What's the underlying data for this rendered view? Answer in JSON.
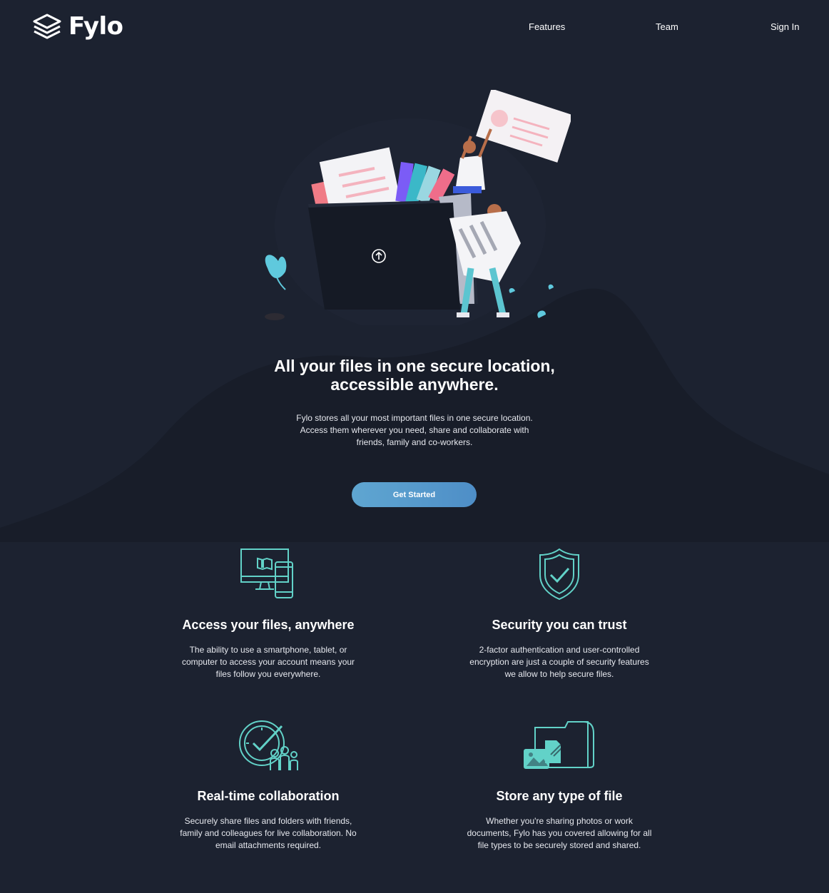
{
  "brand": {
    "name": "Fylo",
    "logo_icon": "stacked-layers-icon"
  },
  "nav": {
    "items": [
      {
        "label": "Features"
      },
      {
        "label": "Team"
      },
      {
        "label": "Sign In"
      }
    ]
  },
  "hero": {
    "title_line1": "All your files in one secure location,",
    "title_line2": "accessible anywhere.",
    "description_line1": "Fylo stores all your most important files in one secure location.",
    "description_line2": "Access them wherever you need, share and collaborate with",
    "description_line3": "friends, family and co-workers.",
    "cta_label": "Get Started"
  },
  "features": [
    {
      "icon": "devices-icon",
      "title": "Access your files, anywhere",
      "lines": [
        "The ability to use a smartphone, tablet, or",
        "computer to access your account means your",
        "files follow you everywhere."
      ]
    },
    {
      "icon": "security-shield-icon",
      "title": "Security you can trust",
      "lines": [
        "2-factor authentication and user-controlled",
        "encryption are just a couple of security features",
        "we allow to help secure files."
      ]
    },
    {
      "icon": "collaboration-icon",
      "title": "Real-time collaboration",
      "lines": [
        "Securely share files and folders with friends,",
        "family and colleagues for live collaboration. No",
        "email attachments required."
      ]
    },
    {
      "icon": "any-file-icon",
      "title": "Store any type of file",
      "lines": [
        "Whether you're sharing photos or work",
        "documents, Fylo has you covered allowing for all",
        "file types to be securely stored and shared."
      ]
    }
  ],
  "colors": {
    "background": "#1c2230",
    "background_curve": "#181d29",
    "accent_teal": "#62d2c8",
    "button_gradient": [
      "#5fa6d1",
      "#4e8ec7"
    ]
  }
}
